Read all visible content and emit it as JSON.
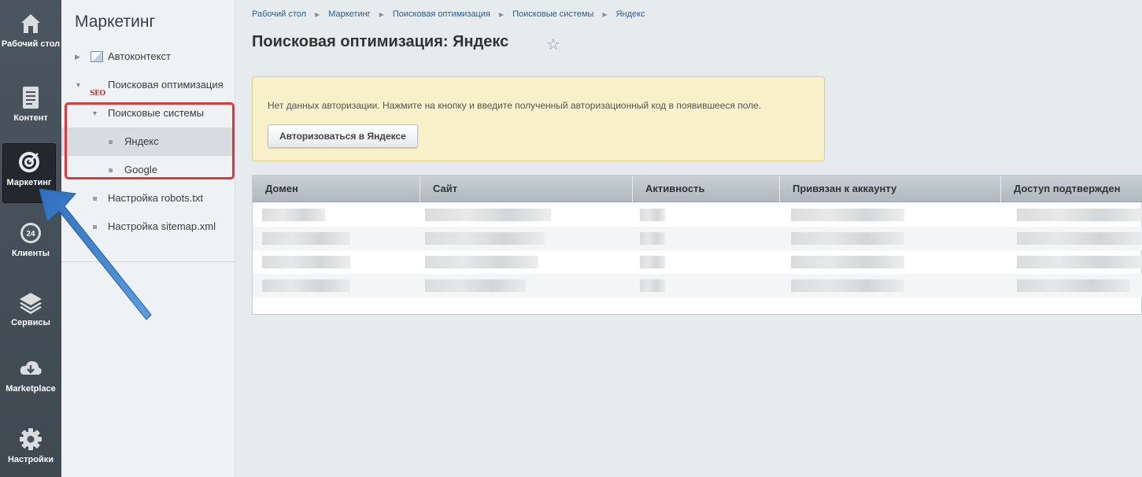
{
  "rail": {
    "items": [
      {
        "label": "Рабочий стол",
        "icon": "home-icon"
      },
      {
        "label": "Контент",
        "icon": "document-icon"
      },
      {
        "label": "Маркетинг",
        "icon": "target-icon"
      },
      {
        "label": "Клиенты",
        "icon": "clients-24-icon"
      },
      {
        "label": "Сервисы",
        "icon": "layers-icon"
      },
      {
        "label": "Marketplace",
        "icon": "cloud-download-icon"
      },
      {
        "label": "Настройки",
        "icon": "gear-icon"
      }
    ]
  },
  "menu": {
    "title": "Маркетинг",
    "items": [
      {
        "label": "Автоконтекст"
      },
      {
        "label": "Поисковая оптимизация",
        "badge": "SEO"
      },
      {
        "label": "Поисковые системы"
      },
      {
        "label": "Яндекс"
      },
      {
        "label": "Google"
      },
      {
        "label": "Настройка robots.txt"
      },
      {
        "label": "Настройка sitemap.xml"
      }
    ]
  },
  "breadcrumb": [
    "Рабочий стол",
    "Маркетинг",
    "Поисковая оптимизация",
    "Поисковые системы",
    "Яндекс"
  ],
  "page": {
    "title": "Поисковая оптимизация: Яндекс",
    "notice_text": "Нет данных авторизации. Нажмите на кнопку и введите полученный авторизационный код в появившееся поле.",
    "auth_button": "Авторизоваться в Яндексе"
  },
  "table": {
    "columns": [
      "Домен",
      "Сайт",
      "Активность",
      "Привязан к аккаунту",
      "Доступ подтвержден"
    ]
  },
  "colors": {
    "rail_bg": "#444e58",
    "highlight_box": "#e0373a",
    "arrow": "#3a7bc8",
    "notice_bg": "#f7f0c8"
  }
}
